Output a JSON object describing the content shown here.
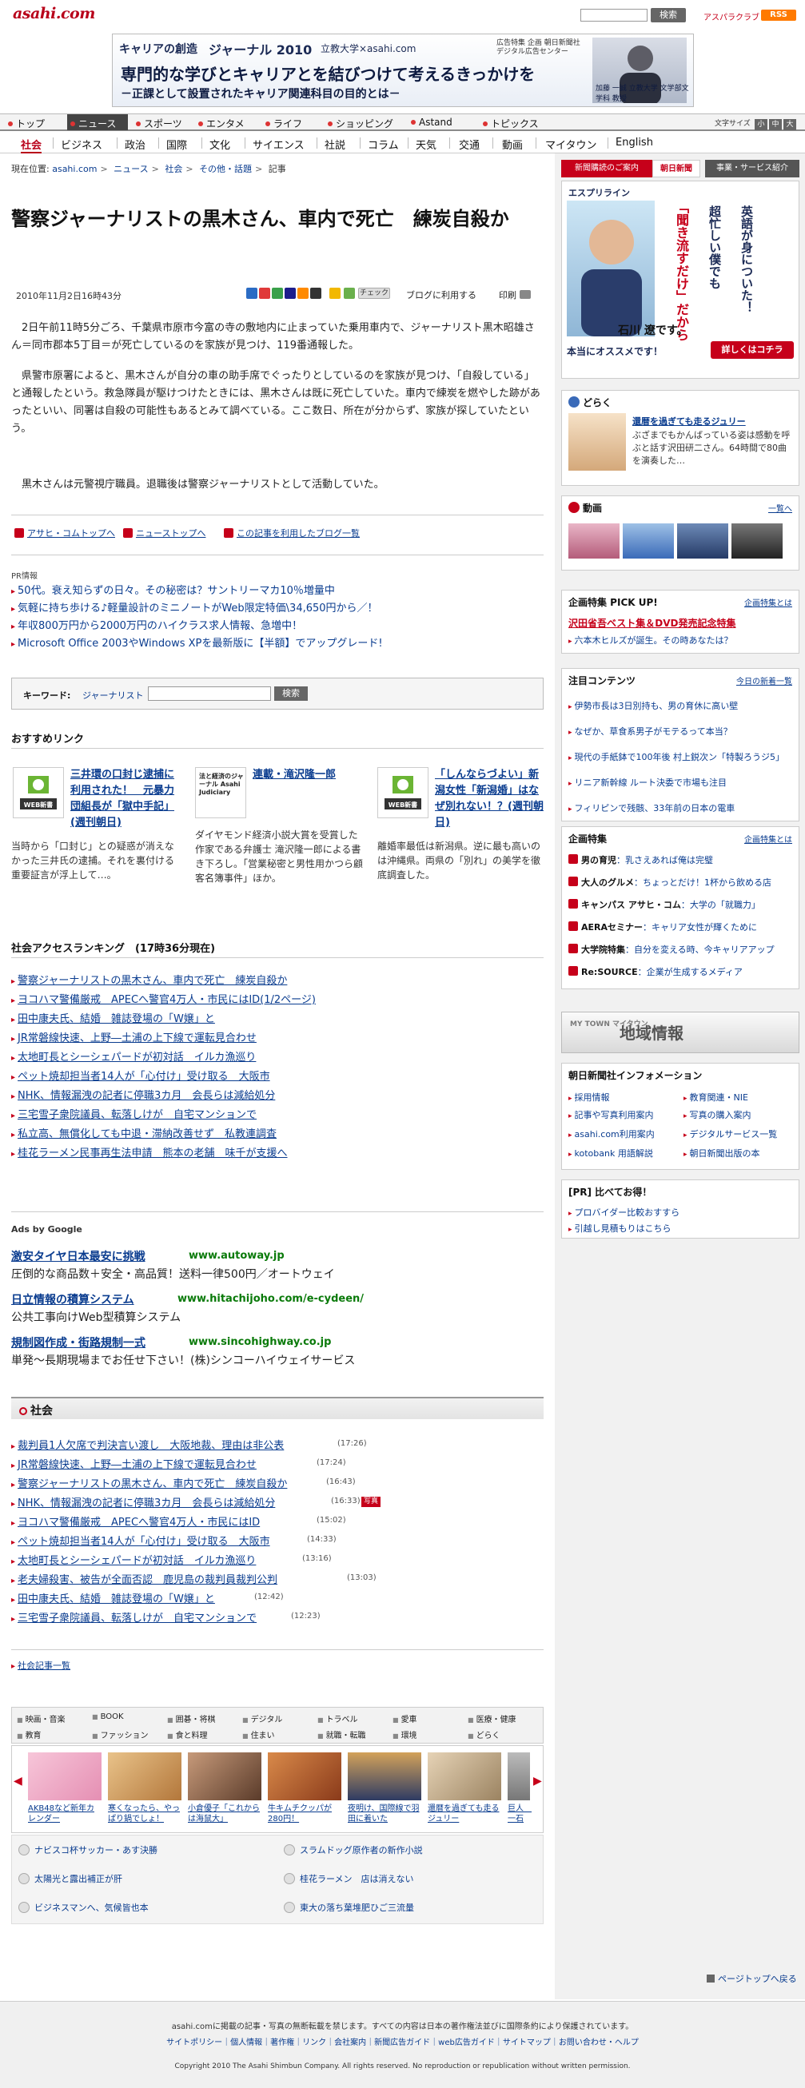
{
  "header": {
    "logo": "asahi.com",
    "search_button": "検索",
    "asahi_sns": "アスパラクラブ",
    "rss": "RSS"
  },
  "banner": {
    "tag": "キャリアの創造",
    "journal": "ジャーナル 2010",
    "sub": "立教大学×asahi.com",
    "pr": "広告特集 企画 朝日新聞社デジタル広告センター",
    "headline": "専門的な学びとキャリアとを結びつけて考えるきっかけを",
    "foot": "－正課として設置されたキャリア関連科目の目的とは－",
    "person": "加藤 一誠 立教大学 文学部文学科 教授"
  },
  "nav_main": [
    "トップ",
    "ニュース",
    "スポーツ",
    "エンタメ",
    "ライフ",
    "ショッピング",
    "Astand",
    "トピックス"
  ],
  "text_size": {
    "label": "文字サイズ",
    "small": "小",
    "medium": "中",
    "large": "大"
  },
  "nav_sub": [
    "社会",
    "ビジネス",
    "政治",
    "国際",
    "文化",
    "サイエンス",
    "社説",
    "コラム",
    "天気",
    "交通",
    "動画",
    "マイタウン",
    "English"
  ],
  "breadcrumb": {
    "label": "現在位置:",
    "items": [
      "asahi.com",
      "ニュース",
      "社会",
      "その他・話題",
      "記事"
    ]
  },
  "article": {
    "title": "警察ジャーナリストの黒木さん、車内で死亡　練炭自殺か",
    "date": "2010年11月2日16時43分",
    "blog_use": "ブログに利用する",
    "print": "印刷",
    "check": "チェック",
    "paragraphs": [
      "2日午前11時5分ごろ、千葉県市原市今富の寺の敷地内に止まっていた乗用車内で、ジャーナリスト黒木昭雄さん＝同市郡本5丁目＝が死亡しているのを家族が見つけ、119番通報した。",
      "県警市原署によると、黒木さんが自分の車の助手席でぐったりとしているのを家族が見つけ、「自殺している」と通報したという。救急隊員が駆けつけたときには、黒木さんは既に死亡していた。車内で練炭を燃やした跡があったといい、同署は自殺の可能性もあるとみて調べている。ここ数日、所在が分からず、家族が探していたという。",
      "黒木さんは元警視庁職員。退職後は警察ジャーナリストとして活動していた。"
    ]
  },
  "tag_links": [
    "アサヒ・コムトップへ",
    "ニューストップへ",
    "この記事を利用したブログ一覧"
  ],
  "pr": {
    "label": "PR情報",
    "items": [
      "50代。衰え知らずの日々。その秘密は？サントリーマカ10％増量中",
      "気軽に持ち歩ける♪軽量設計のミニノートがWeb限定特価\\34,650円から／！",
      "年収800万円から2000万円のハイクラス求人情報、急増中！",
      "Microsoft Office 2003やWindows XPを最新版に【半額】でアップグレード!"
    ]
  },
  "keyword": {
    "label": "キーワード:",
    "value": "ジャーナリスト",
    "button": "検索"
  },
  "recommend": {
    "head": "おすすめリンク",
    "items": [
      {
        "badge": "WEB新書",
        "title": "三井環の口封じ逮捕に利用された！　元暴力団組長が「獄中手記」(週刊朝日)",
        "body": "当時から「口封じ」との疑惑が消えなかった三井氏の逮捕。それを裏付ける重要証言が浮上して…。"
      },
      {
        "badge": "法と経済のジャーナル Asahi Judiciary",
        "title": "連載・滝沢隆一郎",
        "body": "ダイヤモンド経済小説大賞を受賞した作家である弁護士 滝沢隆一郎による書き下ろし。「営業秘密と男性用かつら顧客名簿事件」ほか。"
      },
      {
        "badge": "WEB新書",
        "title": "「しんならづよい」新潟女性「新潟婚」はなぜ別れない！？(週刊朝日)",
        "body": "離婚率最低は新潟県。逆に最も高いのは沖縄県。両県の「別れ」の美学を徹底調査した。"
      }
    ]
  },
  "ranking": {
    "head": "社会アクセスランキング　(17時36分現在)",
    "items": [
      "警察ジャーナリストの黒木さん、車内で死亡　練炭自殺か",
      "ヨコハマ警備厳戒　APECへ警官4万人・市民にはID(1/2ページ)",
      "田中康夫氏、結婚　雑誌登場の「W嬢」と",
      "JR常磐線快速、上野―土浦の上下線で運転見合わせ",
      "太地町長とシーシェパードが初対話　イルカ漁巡り",
      "ペット焼却担当者14人が「心付け」受け取る　大阪市",
      "NHK、情報漏洩の記者に停職3カ月　会長らは減給処分",
      "三宅雪子衆院議員、転落しけが　自宅マンションで",
      "私立高、無償化しても中退・滞納改善せず　私教連調査",
      "桂花ラーメン民事再生法申請　熊本の老舗　味千が支援へ"
    ]
  },
  "ads": {
    "label": "Ads by Google",
    "items": [
      {
        "title": "激安タイヤ日本最安に挑戦",
        "url": "www.autoway.jp",
        "desc": "圧倒的な商品数＋安全・高品質！送料一律500円／オートウェイ"
      },
      {
        "title": "日立情報の積算システム",
        "url": "www.hitachijoho.com/e-cydeen/",
        "desc": "公共工事向けWeb型積算システム"
      },
      {
        "title": "規制図作成・街路規制一式",
        "url": "www.sincohighway.co.jp",
        "desc": "単発～長期現場までお任せ下さい！(株)シンコーハイウェイサービス"
      }
    ]
  },
  "shakai": {
    "head": "社会",
    "photo_badge": "写真",
    "items": [
      {
        "text": "裁判員1人欠席で判決言い渡し　大阪地裁、理由は非公表",
        "time": "(17:26)"
      },
      {
        "text": "JR常磐線快速、上野―土浦の上下線で運転見合わせ",
        "time": "(17:24)"
      },
      {
        "text": "警察ジャーナリストの黒木さん、車内で死亡　練炭自殺か",
        "time": "(16:43)"
      },
      {
        "text": "NHK、情報漏洩の記者に停職3カ月　会長らは減給処分",
        "time": "(16:33)"
      },
      {
        "text": "ヨコハマ警備厳戒　APECへ警官4万人・市民にはID",
        "time": "(15:02)"
      },
      {
        "text": "ペット焼却担当者14人が「心付け」受け取る　大阪市",
        "time": "(14:33)"
      },
      {
        "text": "太地町長とシーシェパードが初対話　イルカ漁巡り",
        "time": "(13:16)"
      },
      {
        "text": "老夫婦殺害、被告が全面否認　鹿児島の裁判員裁判公判",
        "time": "(13:03)"
      },
      {
        "text": "田中康夫氏、結婚　雑誌登場の「W嬢」と",
        "time": "(12:42)"
      },
      {
        "text": "三宅雪子衆院議員、転落しけが　自宅マンションで",
        "time": "(12:23)"
      }
    ],
    "list_link": "社会記事一覧"
  },
  "categories": [
    "映画・音楽",
    "BOOK",
    "囲碁・将棋",
    "デジタル",
    "トラベル",
    "愛車",
    "医療・健康",
    "教育",
    "ファッション",
    "食と料理",
    "住まい",
    "就職・転職",
    "環境",
    "どらく"
  ],
  "carousel": [
    "AKB48など新年カレンダー",
    "寒くなったら、やっぱり鍋でしょ！",
    "小倉優子「これからは海鼠大」",
    "牛キムチクッパが280円！",
    "夜明け、国際線で羽田に着いた",
    "還暦を過ぎても走るジュリー",
    "巨人　一石"
  ],
  "bottom_links": [
    "ナビスコ杯サッカー・あす決勝",
    "スラムドッグ原作者の新作小説",
    "太陽光と露出補正が肝",
    "桂花ラーメン　店は消えない",
    "ビジネスマンへ、気候皆也本",
    "東大の落ち葉堆肥ひご三流量"
  ],
  "right": {
    "tabs": [
      "新聞購読のご案内",
      "朝日新聞",
      "事業・サービス紹介"
    ],
    "ad_english": {
      "brand": "エスプリライン",
      "lines": [
        "「聞き流すだけ」だから",
        "超忙しい僕でも",
        "英語が身についた！"
      ],
      "name": "石川 遼です。",
      "tagline": "本当にオススメです！",
      "cta": "詳しくはコチラ"
    },
    "doraku": {
      "title": "どらく",
      "headline": "還暦を過ぎても走るジュリー",
      "body": "ぶざまでもかんばっている姿は感動を呼ぶと話す沢田研二さん。64時間で80曲を演奏した…"
    },
    "douga": {
      "title": "動画",
      "more": "一覧へ"
    },
    "pickup": {
      "title": "企画特集 PICK UP!",
      "more": "企画特集とは",
      "headline": "沢田省吾ベスト集＆DVD発売記念特集",
      "item": "六本木ヒルズが誕生。その時あなたは？"
    },
    "chumoku": {
      "title": "注目コンテンツ",
      "more": "今日の新着一覧",
      "items": [
        "伊勢市長は3日別持も、男の育休に高い壁",
        "なぜか、草食系男子がモテるって本当？",
        "現代の手紙鉢で100年後 村上鋭次ン「特製ろうジ5」",
        "リニア新幹線 ルート決委で市場も注目",
        "フィリピンで残骸、33年前の日本の電車"
      ]
    },
    "kikaku": {
      "title": "企画特集",
      "more": "企画特集とは",
      "items": [
        {
          "label": "男の育児",
          "text": "乳さえあれば俺は完璧"
        },
        {
          "label": "大人のグルメ",
          "text": "ちょっとだけ！1杯から飲める店"
        },
        {
          "label": "キャンパス アサヒ・コム",
          "text": "大学の「就職力」"
        },
        {
          "label": "AERAセミナー",
          "text": "キャリア女性が輝くために"
        },
        {
          "label": "大学院特集",
          "text": "自分を変える時、今キャリアアップ"
        },
        {
          "label": "Re:SOURCE",
          "text": "企業が生成するメディア"
        }
      ]
    },
    "mytown": {
      "label": "MY TOWN マイタウン",
      "title": "地域情報"
    },
    "info": {
      "title": "朝日新聞社インフォメーション",
      "items": [
        "採用情報",
        "教育関連・NIE",
        "記事や写真利用案内",
        "写真の購入案内",
        "asahi.com利用案内",
        "デジタルサービス一覧",
        "kotobank 用語解説",
        "朝日新聞出版の本"
      ]
    },
    "hikaku": {
      "title": "[PR] 比べてお得！",
      "items": [
        "プロバイダー比較おすすら",
        "引越し見積もりはこちら"
      ]
    }
  },
  "pagetop": "ページトップへ戻る",
  "footer": {
    "line1": "asahi.comに掲載の記事・写真の無断転載を禁じます。すべての内容は日本の著作権法並びに国際条約により保護されています。",
    "links": "サイトポリシー｜個人情報｜著作権｜リンク｜会社案内｜新聞広告ガイド｜web広告ガイド｜サイトマップ｜お問い合わせ・ヘルプ",
    "copyright": "Copyright 2010 The Asahi Shimbun Company. All rights reserved. No reproduction or republication without written permission."
  }
}
